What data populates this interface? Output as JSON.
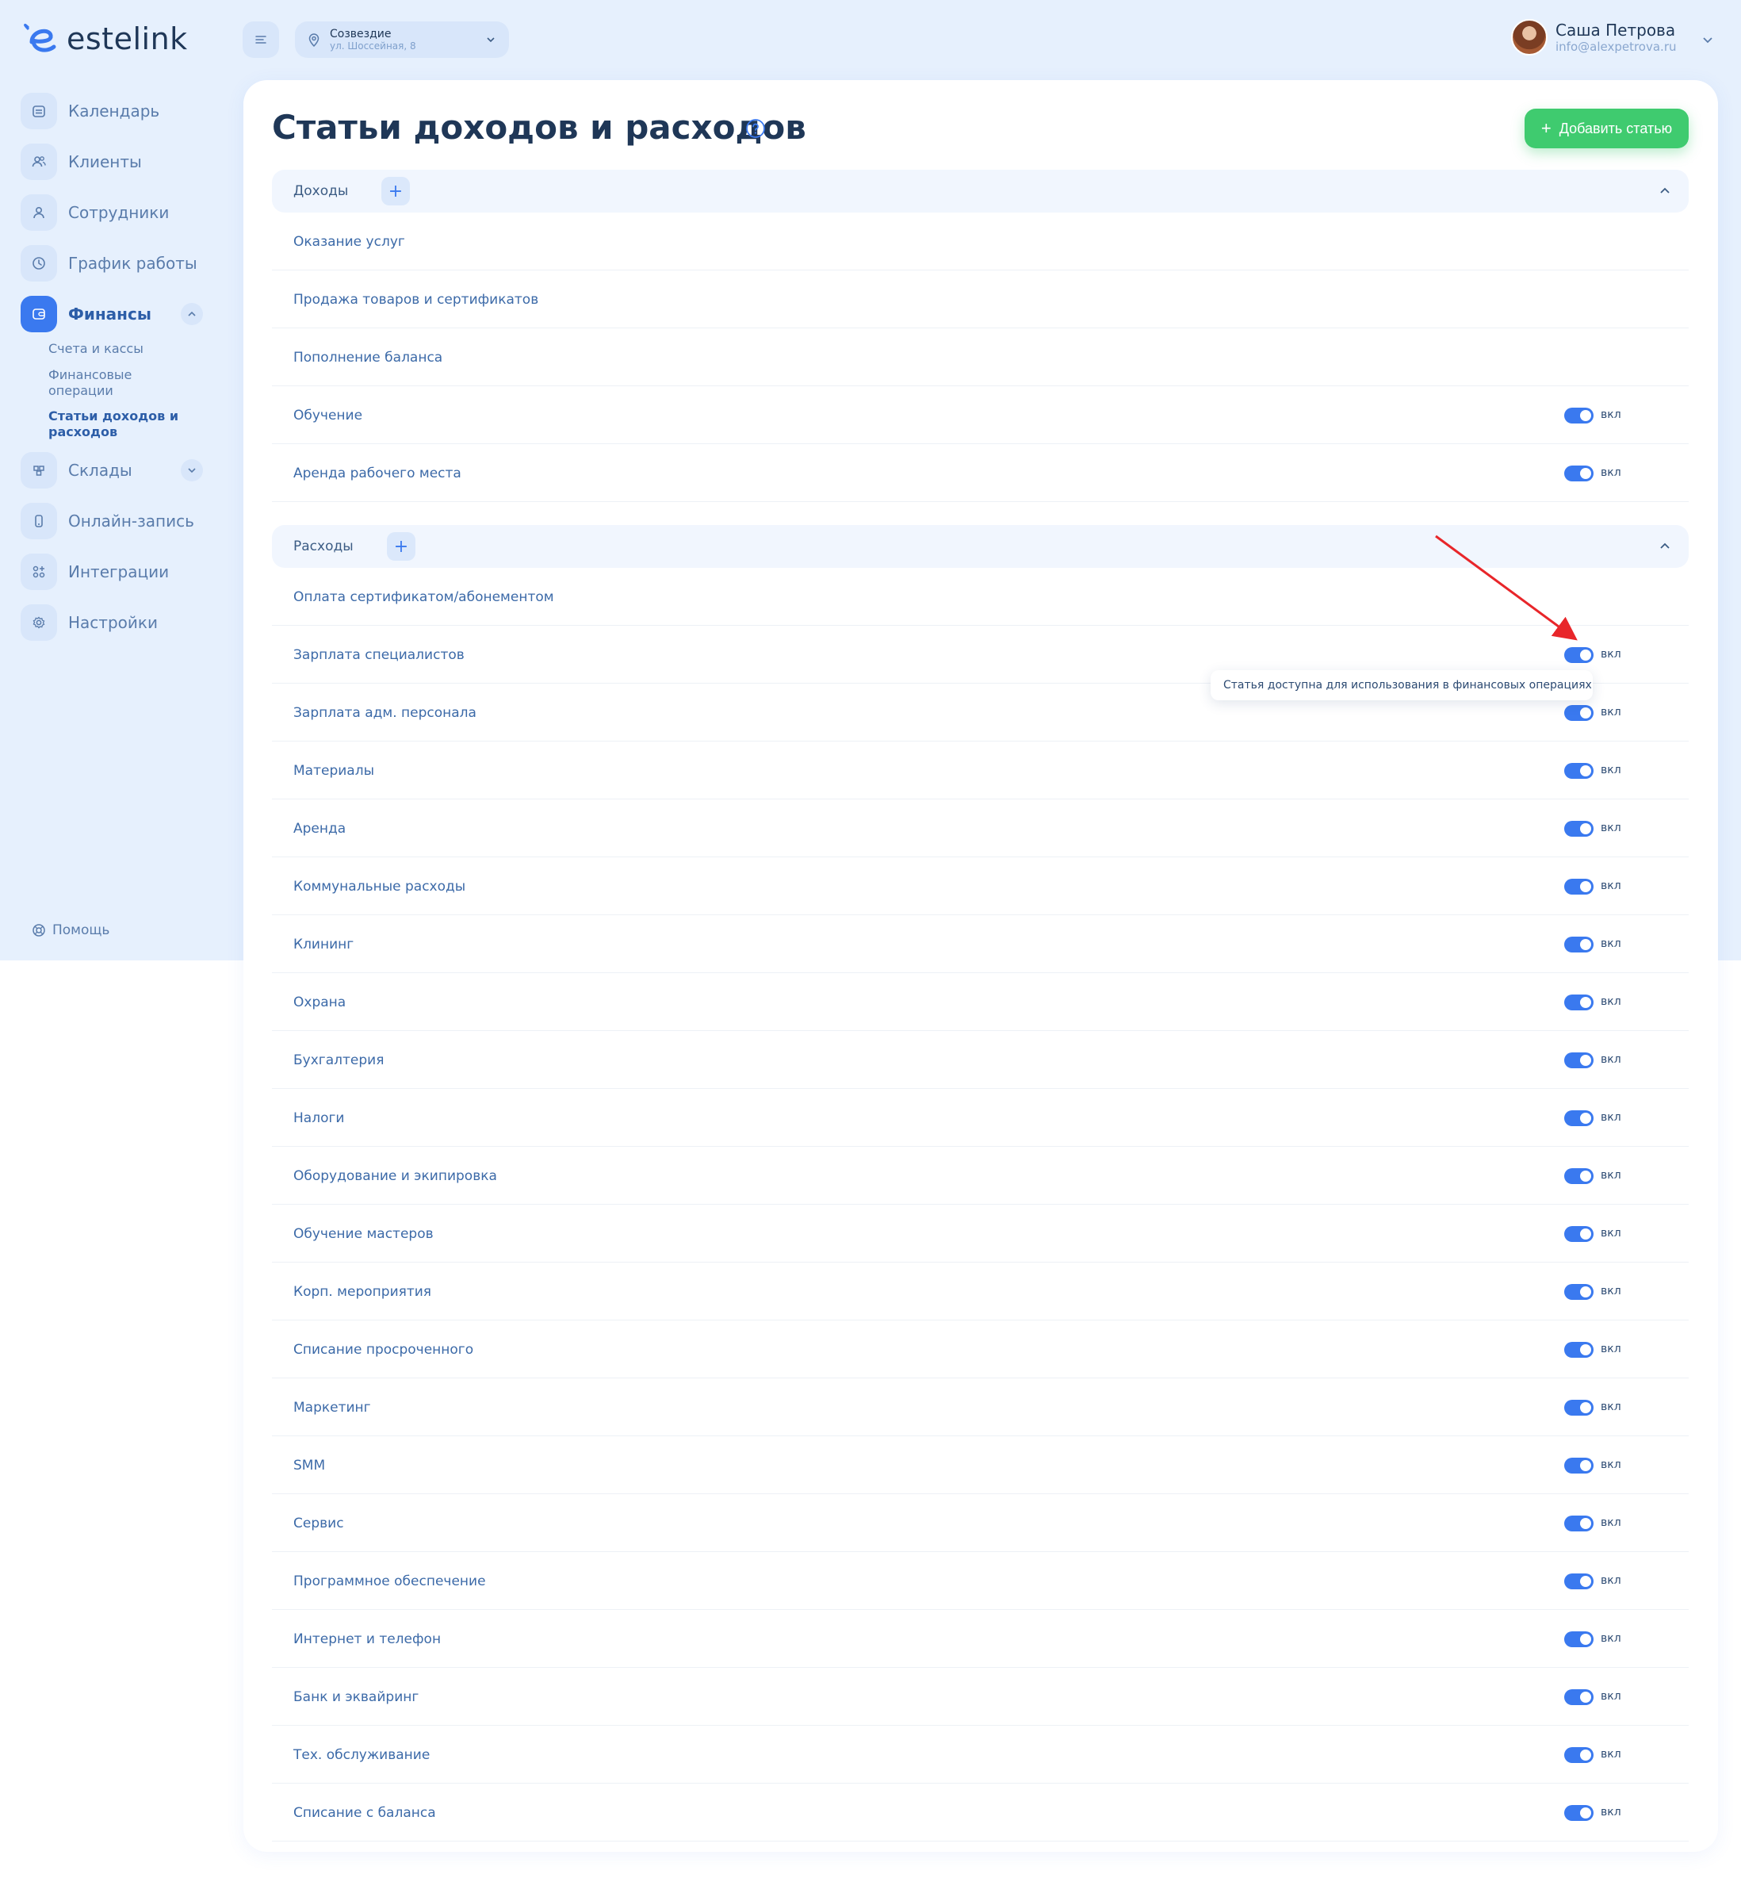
{
  "app": {
    "logo_text": "estelink"
  },
  "sidebar": {
    "items": [
      {
        "label": "Календарь",
        "icon": "calendar-icon"
      },
      {
        "label": "Клиенты",
        "icon": "users-icon"
      },
      {
        "label": "Сотрудники",
        "icon": "user-icon"
      },
      {
        "label": "График работы",
        "icon": "clock-icon"
      },
      {
        "label": "Финансы",
        "icon": "wallet-icon",
        "active": true,
        "expanded": true
      },
      {
        "label": "Склады",
        "icon": "boxes-icon"
      },
      {
        "label": "Онлайн-запись",
        "icon": "phone-icon"
      },
      {
        "label": "Интеграции",
        "icon": "apps-icon"
      },
      {
        "label": "Настройки",
        "icon": "gear-icon"
      }
    ],
    "finance_sub": [
      {
        "label": "Счета и кассы"
      },
      {
        "label": "Финансовые операции"
      },
      {
        "label": "Статьи доходов и расходов",
        "active": true
      }
    ],
    "help_label": "Помощь"
  },
  "topbar": {
    "branch_name": "Созвездие",
    "branch_address": "ул. Шоссейная, 8",
    "user_name": "Саша Петрова",
    "user_email": "info@alexpetrova.ru"
  },
  "page": {
    "title": "Статьи доходов и расходов",
    "add_button": "Добавить статью"
  },
  "income": {
    "title": "Доходы",
    "rows": [
      {
        "label": "Оказание услуг",
        "toggle": false
      },
      {
        "label": "Продажа товаров и сертификатов",
        "toggle": false
      },
      {
        "label": "Пополнение баланса",
        "toggle": false
      },
      {
        "label": "Обучение",
        "toggle": true,
        "state": "вкл"
      },
      {
        "label": "Аренда рабочего места",
        "toggle": true,
        "state": "вкл"
      }
    ]
  },
  "expenses": {
    "title": "Расходы",
    "rows": [
      {
        "label": "Оплата сертификатом/абонементом",
        "toggle": false
      },
      {
        "label": "Зарплата специалистов",
        "toggle": true,
        "state": "вкл"
      },
      {
        "label": "Зарплата адм. персонала",
        "toggle": true,
        "state": "вкл"
      },
      {
        "label": "Материалы",
        "toggle": true,
        "state": "вкл"
      },
      {
        "label": "Аренда",
        "toggle": true,
        "state": "вкл"
      },
      {
        "label": "Коммунальные расходы",
        "toggle": true,
        "state": "вкл"
      },
      {
        "label": "Клининг",
        "toggle": true,
        "state": "вкл"
      },
      {
        "label": "Охрана",
        "toggle": true,
        "state": "вкл"
      },
      {
        "label": "Бухгалтерия",
        "toggle": true,
        "state": "вкл"
      },
      {
        "label": "Налоги",
        "toggle": true,
        "state": "вкл"
      },
      {
        "label": "Оборудование и экипировка",
        "toggle": true,
        "state": "вкл"
      },
      {
        "label": "Обучение мастеров",
        "toggle": true,
        "state": "вкл"
      },
      {
        "label": "Корп. мероприятия",
        "toggle": true,
        "state": "вкл"
      },
      {
        "label": "Списание просроченного",
        "toggle": true,
        "state": "вкл"
      },
      {
        "label": "Маркетинг",
        "toggle": true,
        "state": "вкл"
      },
      {
        "label": "SMM",
        "toggle": true,
        "state": "вкл"
      },
      {
        "label": "Сервис",
        "toggle": true,
        "state": "вкл"
      },
      {
        "label": "Программное обеспечение",
        "toggle": true,
        "state": "вкл"
      },
      {
        "label": "Интернет и телефон",
        "toggle": true,
        "state": "вкл"
      },
      {
        "label": "Банк и эквайринг",
        "toggle": true,
        "state": "вкл"
      },
      {
        "label": "Тех. обслуживание",
        "toggle": true,
        "state": "вкл"
      },
      {
        "label": "Списание с баланса",
        "toggle": true,
        "state": "вкл"
      }
    ]
  },
  "tooltip": {
    "text": "Статья доступна для использования в финансовых операциях"
  },
  "colors": {
    "accent": "#3a79ef",
    "add_button": "#3fcb6f",
    "sidebar_bg": "#e6f0fd",
    "annotation_arrow": "#e8262a"
  }
}
